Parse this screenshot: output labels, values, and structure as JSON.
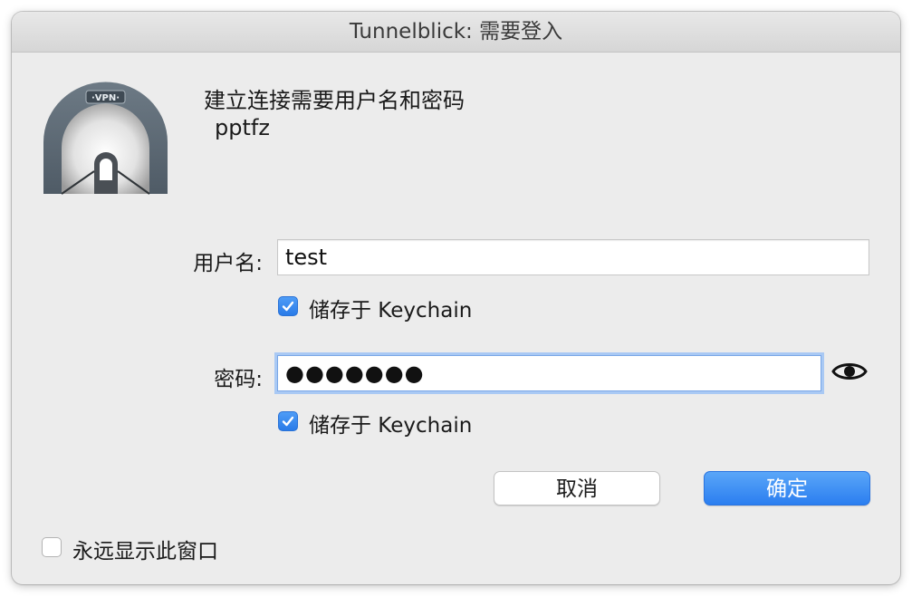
{
  "window": {
    "title": "Tunnelblick: 需要登入"
  },
  "icon": {
    "name": "vpn-tunnel-icon",
    "badge_text": "·VPN·"
  },
  "message": {
    "line1": "建立连接需要用户名和密码",
    "line2": "pptfz"
  },
  "username": {
    "label": "用户名:",
    "value": "test",
    "save_keychain_label": "储存于 Keychain",
    "save_keychain_checked": true
  },
  "password": {
    "label": "密码:",
    "value": "●●●●●●●",
    "save_keychain_label": "储存于 Keychain",
    "save_keychain_checked": true,
    "reveal_icon": "eye-icon"
  },
  "buttons": {
    "cancel_label": "取消",
    "ok_label": "确定"
  },
  "always_show": {
    "label": "永远显示此窗口",
    "checked": false
  },
  "colors": {
    "accent": "#2b7ef0",
    "window_bg": "#ececec",
    "focus_ring": "#a9c9f4"
  }
}
